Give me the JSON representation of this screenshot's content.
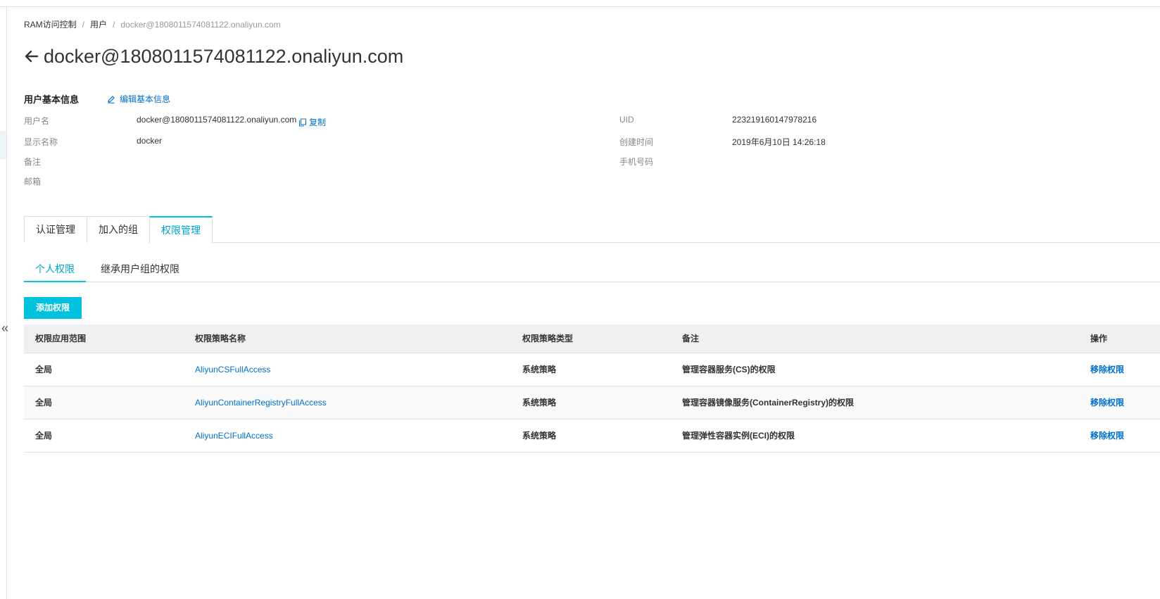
{
  "breadcrumb": {
    "root": "RAM访问控制",
    "level2": "用户",
    "current": "docker@1808011574081122.onaliyun.com"
  },
  "page": {
    "title": "docker@1808011574081122.onaliyun.com"
  },
  "basic_info": {
    "section_title": "用户基本信息",
    "edit_label": "编辑基本信息",
    "copy_label": "复制",
    "fields": {
      "username_label": "用户名",
      "username_value": "docker@1808011574081122.onaliyun.com",
      "display_name_label": "显示名称",
      "display_name_value": "docker",
      "note_label": "备注",
      "email_label": "邮箱",
      "uid_label": "UID",
      "uid_value": "223219160147978216",
      "created_label": "创建时间",
      "created_value": "2019年6月10日 14:26:18",
      "phone_label": "手机号码"
    }
  },
  "tabs": [
    {
      "label": "认证管理"
    },
    {
      "label": "加入的组"
    },
    {
      "label": "权限管理",
      "active": true
    }
  ],
  "subtabs": [
    {
      "label": "个人权限",
      "active": true
    },
    {
      "label": "继承用户组的权限"
    }
  ],
  "add_button": "添加权限",
  "table": {
    "headers": [
      "权限应用范围",
      "权限策略名称",
      "权限策略类型",
      "备注",
      "操作"
    ],
    "rows": [
      {
        "scope": "全局",
        "policy": "AliyunCSFullAccess",
        "type": "系统策略",
        "note": "管理容器服务(CS)的权限",
        "action": "移除权限"
      },
      {
        "scope": "全局",
        "policy": "AliyunContainerRegistryFullAccess",
        "type": "系统策略",
        "note": "管理容器镜像服务(ContainerRegistry)的权限",
        "action": "移除权限"
      },
      {
        "scope": "全局",
        "policy": "AliyunECIFullAccess",
        "type": "系统策略",
        "note": "管理弹性容器实例(ECI)的权限",
        "action": "移除权限"
      }
    ]
  },
  "colors": {
    "accent": "#00c1de",
    "link": "#0070cc",
    "active_text": "#00a2ca"
  },
  "icons": {
    "back": "arrow-left-icon",
    "edit": "pencil-icon",
    "copy": "copy-icon",
    "collapse": "double-chevron-left-icon"
  }
}
